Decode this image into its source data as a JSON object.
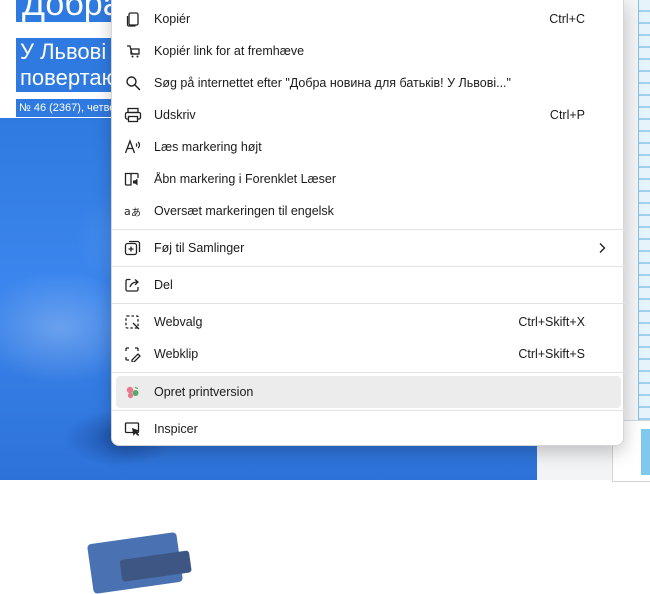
{
  "background": {
    "title_fragment": "Добра",
    "subtitle_line1": "У Львові",
    "subtitle_line2": "повертаю",
    "issue_line": "№ 46 (2367), четве",
    "accent_color": "#2f7ae0"
  },
  "menu": {
    "items": [
      {
        "label": "Kopiér",
        "shortcut": "Ctrl+C",
        "icon": "copy-icon"
      },
      {
        "label": "Kopiér link for at fremhæve",
        "shortcut": "",
        "icon": "copy-link-icon"
      },
      {
        "label": "Søg på internettet efter \"Добра новина для батьків! У Львові...\"",
        "shortcut": "",
        "icon": "search-icon"
      },
      {
        "label": "Udskriv",
        "shortcut": "Ctrl+P",
        "icon": "printer-icon"
      },
      {
        "label": "Læs markering højt",
        "shortcut": "",
        "icon": "read-aloud-icon"
      },
      {
        "label": "Åbn markering i Forenklet Læser",
        "shortcut": "",
        "icon": "immersive-reader-icon"
      },
      {
        "label": "Oversæt markeringen til engelsk",
        "shortcut": "",
        "icon": "translate-icon"
      },
      {
        "label": "Føj til Samlinger",
        "shortcut": "",
        "icon": "collections-icon",
        "submenu": true
      },
      {
        "label": "Del",
        "shortcut": "",
        "icon": "share-icon"
      },
      {
        "label": "Webvalg",
        "shortcut": "Ctrl+Skift+X",
        "icon": "web-select-icon"
      },
      {
        "label": "Webklip",
        "shortcut": "Ctrl+Skift+S",
        "icon": "web-capture-icon"
      },
      {
        "label": "Opret printversion",
        "shortcut": "",
        "icon": "print-friendly-icon",
        "hovered": true
      },
      {
        "label": "Inspicer",
        "shortcut": "",
        "icon": "inspect-icon"
      }
    ]
  }
}
